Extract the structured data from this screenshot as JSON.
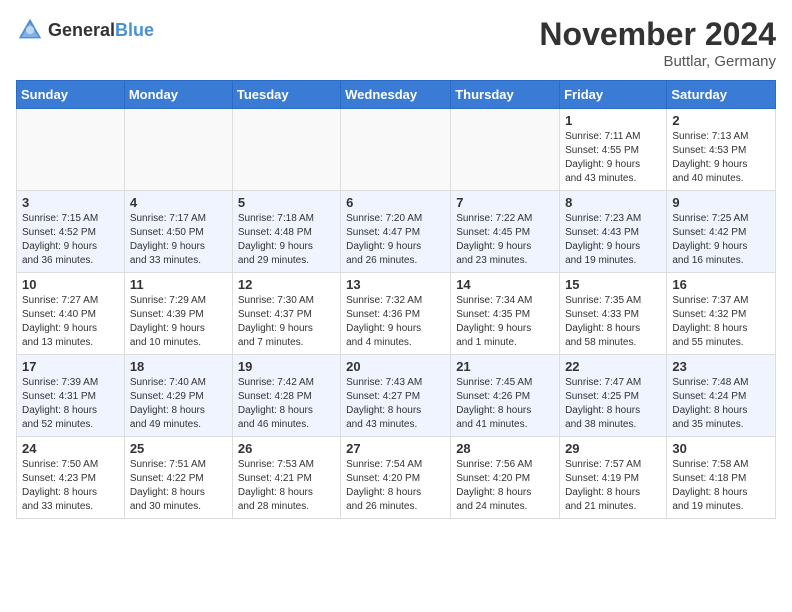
{
  "header": {
    "logo_general": "General",
    "logo_blue": "Blue",
    "month_title": "November 2024",
    "location": "Buttlar, Germany"
  },
  "columns": [
    "Sunday",
    "Monday",
    "Tuesday",
    "Wednesday",
    "Thursday",
    "Friday",
    "Saturday"
  ],
  "weeks": [
    [
      {
        "day": "",
        "info": ""
      },
      {
        "day": "",
        "info": ""
      },
      {
        "day": "",
        "info": ""
      },
      {
        "day": "",
        "info": ""
      },
      {
        "day": "",
        "info": ""
      },
      {
        "day": "1",
        "info": "Sunrise: 7:11 AM\nSunset: 4:55 PM\nDaylight: 9 hours\nand 43 minutes."
      },
      {
        "day": "2",
        "info": "Sunrise: 7:13 AM\nSunset: 4:53 PM\nDaylight: 9 hours\nand 40 minutes."
      }
    ],
    [
      {
        "day": "3",
        "info": "Sunrise: 7:15 AM\nSunset: 4:52 PM\nDaylight: 9 hours\nand 36 minutes."
      },
      {
        "day": "4",
        "info": "Sunrise: 7:17 AM\nSunset: 4:50 PM\nDaylight: 9 hours\nand 33 minutes."
      },
      {
        "day": "5",
        "info": "Sunrise: 7:18 AM\nSunset: 4:48 PM\nDaylight: 9 hours\nand 29 minutes."
      },
      {
        "day": "6",
        "info": "Sunrise: 7:20 AM\nSunset: 4:47 PM\nDaylight: 9 hours\nand 26 minutes."
      },
      {
        "day": "7",
        "info": "Sunrise: 7:22 AM\nSunset: 4:45 PM\nDaylight: 9 hours\nand 23 minutes."
      },
      {
        "day": "8",
        "info": "Sunrise: 7:23 AM\nSunset: 4:43 PM\nDaylight: 9 hours\nand 19 minutes."
      },
      {
        "day": "9",
        "info": "Sunrise: 7:25 AM\nSunset: 4:42 PM\nDaylight: 9 hours\nand 16 minutes."
      }
    ],
    [
      {
        "day": "10",
        "info": "Sunrise: 7:27 AM\nSunset: 4:40 PM\nDaylight: 9 hours\nand 13 minutes."
      },
      {
        "day": "11",
        "info": "Sunrise: 7:29 AM\nSunset: 4:39 PM\nDaylight: 9 hours\nand 10 minutes."
      },
      {
        "day": "12",
        "info": "Sunrise: 7:30 AM\nSunset: 4:37 PM\nDaylight: 9 hours\nand 7 minutes."
      },
      {
        "day": "13",
        "info": "Sunrise: 7:32 AM\nSunset: 4:36 PM\nDaylight: 9 hours\nand 4 minutes."
      },
      {
        "day": "14",
        "info": "Sunrise: 7:34 AM\nSunset: 4:35 PM\nDaylight: 9 hours\nand 1 minute."
      },
      {
        "day": "15",
        "info": "Sunrise: 7:35 AM\nSunset: 4:33 PM\nDaylight: 8 hours\nand 58 minutes."
      },
      {
        "day": "16",
        "info": "Sunrise: 7:37 AM\nSunset: 4:32 PM\nDaylight: 8 hours\nand 55 minutes."
      }
    ],
    [
      {
        "day": "17",
        "info": "Sunrise: 7:39 AM\nSunset: 4:31 PM\nDaylight: 8 hours\nand 52 minutes."
      },
      {
        "day": "18",
        "info": "Sunrise: 7:40 AM\nSunset: 4:29 PM\nDaylight: 8 hours\nand 49 minutes."
      },
      {
        "day": "19",
        "info": "Sunrise: 7:42 AM\nSunset: 4:28 PM\nDaylight: 8 hours\nand 46 minutes."
      },
      {
        "day": "20",
        "info": "Sunrise: 7:43 AM\nSunset: 4:27 PM\nDaylight: 8 hours\nand 43 minutes."
      },
      {
        "day": "21",
        "info": "Sunrise: 7:45 AM\nSunset: 4:26 PM\nDaylight: 8 hours\nand 41 minutes."
      },
      {
        "day": "22",
        "info": "Sunrise: 7:47 AM\nSunset: 4:25 PM\nDaylight: 8 hours\nand 38 minutes."
      },
      {
        "day": "23",
        "info": "Sunrise: 7:48 AM\nSunset: 4:24 PM\nDaylight: 8 hours\nand 35 minutes."
      }
    ],
    [
      {
        "day": "24",
        "info": "Sunrise: 7:50 AM\nSunset: 4:23 PM\nDaylight: 8 hours\nand 33 minutes."
      },
      {
        "day": "25",
        "info": "Sunrise: 7:51 AM\nSunset: 4:22 PM\nDaylight: 8 hours\nand 30 minutes."
      },
      {
        "day": "26",
        "info": "Sunrise: 7:53 AM\nSunset: 4:21 PM\nDaylight: 8 hours\nand 28 minutes."
      },
      {
        "day": "27",
        "info": "Sunrise: 7:54 AM\nSunset: 4:20 PM\nDaylight: 8 hours\nand 26 minutes."
      },
      {
        "day": "28",
        "info": "Sunrise: 7:56 AM\nSunset: 4:20 PM\nDaylight: 8 hours\nand 24 minutes."
      },
      {
        "day": "29",
        "info": "Sunrise: 7:57 AM\nSunset: 4:19 PM\nDaylight: 8 hours\nand 21 minutes."
      },
      {
        "day": "30",
        "info": "Sunrise: 7:58 AM\nSunset: 4:18 PM\nDaylight: 8 hours\nand 19 minutes."
      }
    ]
  ]
}
